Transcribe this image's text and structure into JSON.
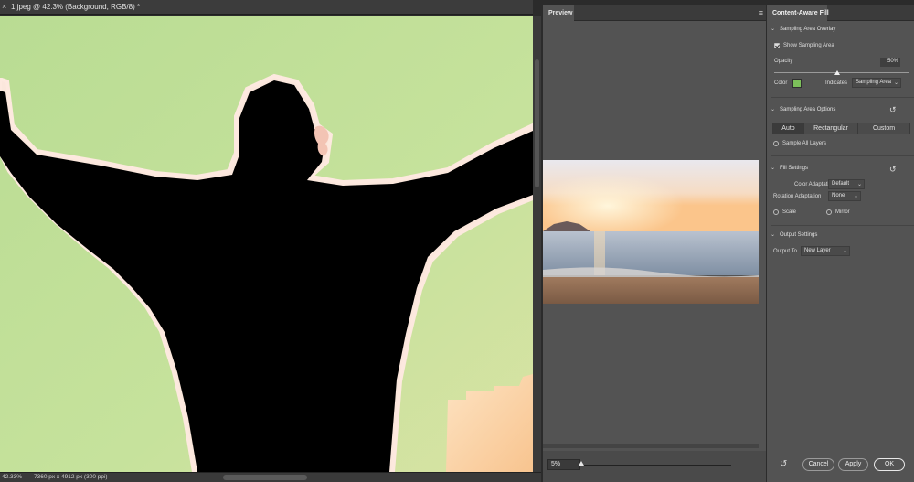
{
  "document": {
    "tab_title": "1.jpeg @ 42.3% (Background, RGB/8) *",
    "close_glyph": "×"
  },
  "status_bar": {
    "zoom": "42.33%",
    "dimensions": "7360 px x 4912 px (300 ppi)"
  },
  "preview_panel": {
    "title": "Preview",
    "menu_icon": "hamburger-menu-icon",
    "zoom_percent": "5%",
    "zoom_level": 0.05
  },
  "content_aware_fill": {
    "title": "Content-Aware Fill",
    "sampling_area_overlay": {
      "title": "Sampling Area Overlay",
      "show_sampling_area_label": "Show Sampling Area",
      "show_sampling_area": true,
      "opacity_label": "Opacity",
      "opacity_value": "50%",
      "opacity": 0.5,
      "color_label": "Color",
      "color": "#7cc05a",
      "indicates_label": "Indicates",
      "indicates_value": "Sampling Area"
    },
    "sampling_area_options": {
      "title": "Sampling Area Options",
      "modes": [
        "Auto",
        "Rectangular",
        "Custom"
      ],
      "selected_mode": "Auto",
      "sample_all_layers_label": "Sample All Layers",
      "sample_all_layers": false
    },
    "fill_settings": {
      "title": "Fill Settings",
      "color_adaptation_label": "Color Adaptation",
      "color_adaptation_value": "Default",
      "rotation_adaptation_label": "Rotation Adaptation",
      "rotation_adaptation_value": "None",
      "scale_label": "Scale",
      "scale": false,
      "mirror_label": "Mirror",
      "mirror": false
    },
    "output_settings": {
      "title": "Output Settings",
      "output_to_label": "Output To",
      "output_to_value": "New Layer"
    },
    "footer": {
      "cancel_label": "Cancel",
      "apply_label": "Apply",
      "ok_label": "OK"
    }
  },
  "colors": {
    "panel_bg": "#535353",
    "app_bg": "#2b2b2b",
    "overlay_green": "#c2e09a",
    "silhouette": "#000000"
  }
}
